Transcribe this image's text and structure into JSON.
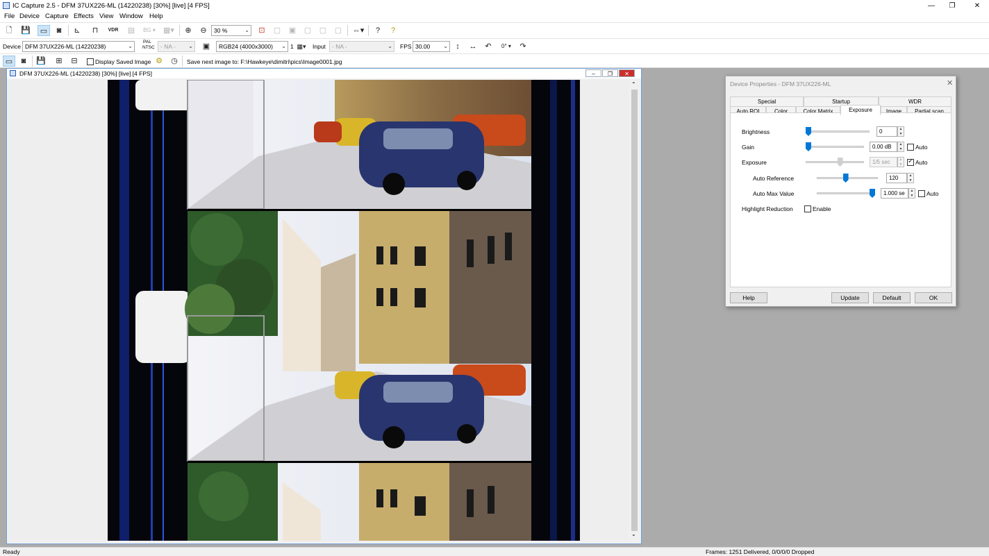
{
  "app": {
    "title": "IC Capture 2.5 - DFM 37UX226-ML (14220238) [30%]  [live]  [4 FPS]",
    "minimize": "—",
    "maximize": "❐",
    "close": "✕"
  },
  "menu": [
    "File",
    "Device",
    "Capture",
    "Effects",
    "View",
    "Window",
    "Help"
  ],
  "toolbar1": {
    "bg_label": "BG",
    "zoom_value": "30 %",
    "rotation_value": "0°"
  },
  "toolbar2": {
    "device_label": "Device",
    "device_value": "DFM 37UX226-ML (14220238)",
    "pal_label": "PAL",
    "ntsc_label": "NTSC",
    "videonorm_value": "- NA -",
    "format_value": "RGB24 (4000x3000)",
    "format_count": "1",
    "input_label": "Input",
    "input_value": "- NA -",
    "fps_label": "FPS",
    "fps_value": "30.00"
  },
  "toolbar3": {
    "display_saved_label": "Display Saved Image",
    "save_next_text": "Save next image to: F:\\Hawkeye\\dimitri\\pics\\Image0001.jpg"
  },
  "child_window": {
    "title": "DFM 37UX226-ML (14220238) [30%]  [live]  [4 FPS]"
  },
  "dialog": {
    "title": "Device Properties - DFM 37UX226-ML",
    "tabs_row1": [
      "Special",
      "Startup",
      "WDR"
    ],
    "tabs_row2": [
      "Auto ROI",
      "Color",
      "Color Matrix",
      "Exposure",
      "Image",
      "Partial scan"
    ],
    "selected_tab": "Exposure",
    "brightness": {
      "label": "Brightness",
      "value": "0",
      "level": 0
    },
    "gain": {
      "label": "Gain",
      "value": "0.00 dB",
      "level": 0,
      "auto_label": "Auto",
      "auto": false
    },
    "exposure": {
      "label": "Exposure",
      "value": "1/5 sec",
      "level": 0.6,
      "auto_label": "Auto",
      "auto": true
    },
    "auto_reference": {
      "label": "Auto Reference",
      "value": "120",
      "level": 0.47
    },
    "auto_max_value": {
      "label": "Auto Max Value",
      "value": "1.000 se",
      "level": 1.0,
      "auto_label": "Auto",
      "auto": false
    },
    "highlight_reduction": {
      "label": "Highlight Reduction",
      "enable_label": "Enable",
      "enabled": false
    },
    "buttons": {
      "help": "Help",
      "update": "Update",
      "default": "Default",
      "ok": "OK"
    }
  },
  "status": {
    "left": "Ready",
    "right": "Frames: 1251 Delivered, 0/0/0/0 Dropped"
  }
}
